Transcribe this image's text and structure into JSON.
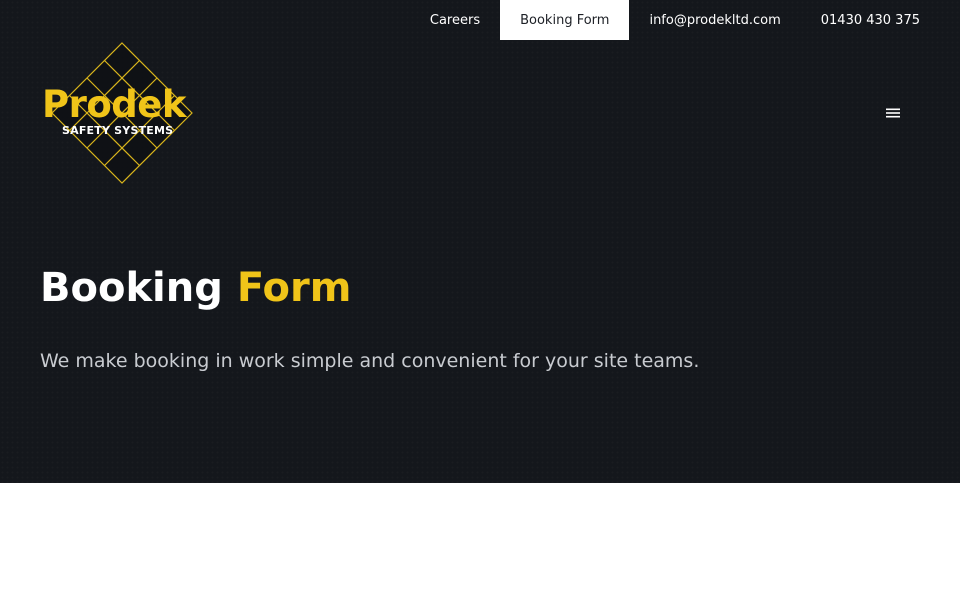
{
  "nav": {
    "items": [
      {
        "label": "Careers",
        "active": false
      },
      {
        "label": "Booking Form",
        "active": true
      },
      {
        "label": "info@prodekltd.com",
        "active": false
      },
      {
        "label": "01430 430 375",
        "active": false
      }
    ]
  },
  "logo": {
    "name": "Prodek",
    "tagline": "SAFETY SYSTEMS"
  },
  "menu": {
    "icon": "hamburger-menu-icon"
  },
  "hero": {
    "title_main": "Booking",
    "title_accent": "Form",
    "subtitle": "We make booking in work simple and convenient for your site teams."
  },
  "colors": {
    "background": "#14171c",
    "accent": "#f0c419",
    "text": "#ffffff",
    "subtext": "#c8cbd0"
  }
}
